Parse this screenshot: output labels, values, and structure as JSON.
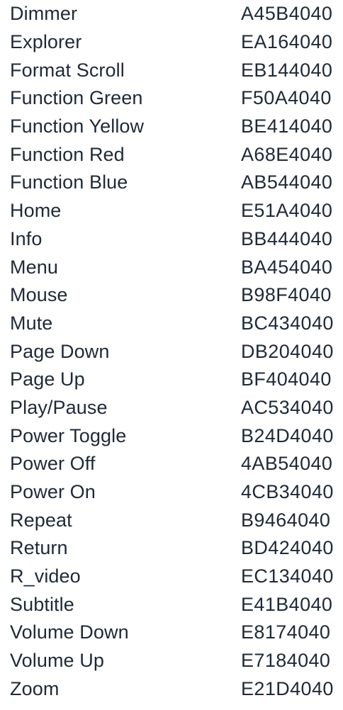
{
  "rows": [
    {
      "name": "Dimmer",
      "code": "A45B4040"
    },
    {
      "name": "Explorer",
      "code": "EA164040"
    },
    {
      "name": "Format Scroll",
      "code": "EB144040"
    },
    {
      "name": "Function Green",
      "code": "F50A4040"
    },
    {
      "name": "Function Yellow",
      "code": "BE414040"
    },
    {
      "name": "Function Red",
      "code": "A68E4040"
    },
    {
      "name": "Function Blue",
      "code": "AB544040"
    },
    {
      "name": "Home",
      "code": "E51A4040"
    },
    {
      "name": "Info",
      "code": "BB444040"
    },
    {
      "name": "Menu",
      "code": "BA454040"
    },
    {
      "name": "Mouse",
      "code": "B98F4040"
    },
    {
      "name": "Mute",
      "code": "BC434040"
    },
    {
      "name": "Page Down",
      "code": "DB204040"
    },
    {
      "name": "Page Up",
      "code": "BF404040"
    },
    {
      "name": "Play/Pause",
      "code": "AC534040"
    },
    {
      "name": "Power Toggle",
      "code": "B24D4040"
    },
    {
      "name": "Power Off",
      "code": "4AB54040"
    },
    {
      "name": "Power On",
      "code": "4CB34040"
    },
    {
      "name": "Repeat",
      "code": "B9464040"
    },
    {
      "name": "Return",
      "code": "BD424040"
    },
    {
      "name": "R_video",
      "code": "EC134040"
    },
    {
      "name": "Subtitle",
      "code": "E41B4040"
    },
    {
      "name": "Volume Down",
      "code": "E8174040"
    },
    {
      "name": "Volume Up",
      "code": "E7184040"
    },
    {
      "name": "Zoom",
      "code": "E21D4040"
    }
  ]
}
